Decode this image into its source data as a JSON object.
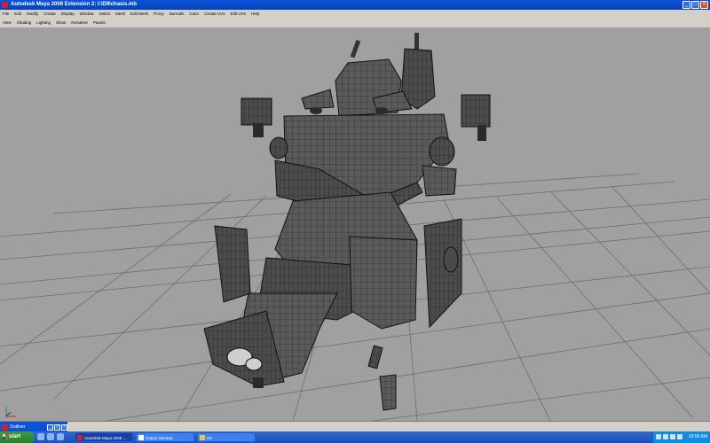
{
  "window": {
    "title": "Autodesk Maya 2008 Extension 2: I:\\D9\\chasis.mb"
  },
  "menu": [
    "File",
    "Edit",
    "Modify",
    "Create",
    "Display",
    "Window",
    "Select",
    "Mesh",
    "Edit Mesh",
    "Proxy",
    "Normals",
    "Color",
    "Create UVs",
    "Edit UVs",
    "Help"
  ],
  "panel_menu": [
    "View",
    "Shading",
    "Lighting",
    "Show",
    "Renderer",
    "Panels"
  ],
  "viewport": {
    "camera": "persp",
    "background": "#a0a0a0"
  },
  "outliner": {
    "title": "Outliner"
  },
  "taskbar": {
    "start": "start",
    "tasks": [
      {
        "label": "Autodesk Maya 2008 ...",
        "active": true
      },
      {
        "label": "Output Window",
        "active": false
      },
      {
        "label": "D9",
        "active": false
      }
    ],
    "clock": "10:56 AM"
  }
}
